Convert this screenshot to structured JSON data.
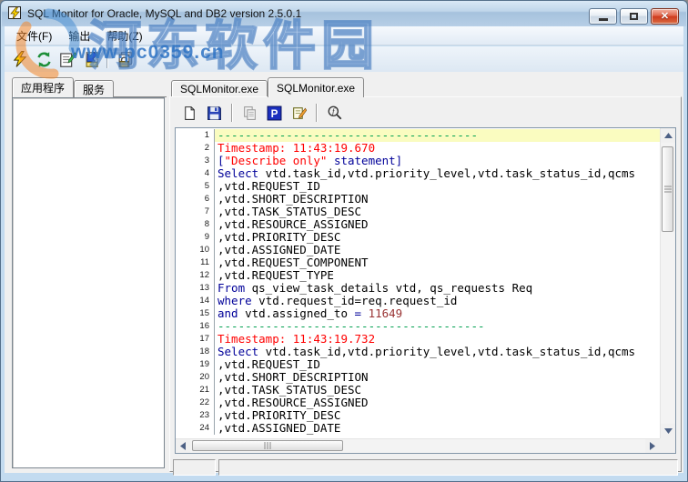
{
  "window": {
    "title": "SQL Monitor for Oracle, MySQL and DB2 version 2.5.0.1",
    "controls": [
      "minimize",
      "maximize",
      "close"
    ]
  },
  "menu": {
    "items": [
      "文件(F)",
      "输出",
      "帮助(Z)"
    ]
  },
  "main_toolbar": {
    "icons": [
      "execute-icon",
      "refresh-icon",
      "log-options-icon",
      "save-output-icon",
      "lock-icon"
    ]
  },
  "left_panel": {
    "tabs": [
      {
        "label": "应用程序",
        "active": true
      },
      {
        "label": "服务",
        "active": false
      }
    ],
    "process_list": []
  },
  "right_panel": {
    "tabs": [
      {
        "label": "SQLMonitor.exe",
        "active": false
      },
      {
        "label": "SQLMonitor.exe",
        "active": true
      }
    ],
    "toolbar": {
      "icons": [
        "new-file-icon",
        "save-icon",
        "copy-icon",
        "pause-icon",
        "clear-icon",
        "find-icon"
      ]
    },
    "editor": {
      "lines": [
        {
          "n": 1,
          "hl": true,
          "seg": [
            [
              "green",
              "--------------------------------------"
            ]
          ]
        },
        {
          "n": 2,
          "seg": [
            [
              "red",
              "Timestamp: 11:43:19.670"
            ]
          ]
        },
        {
          "n": 3,
          "seg": [
            [
              "navy",
              "["
            ],
            [
              "red",
              "\"Describe only\""
            ],
            [
              "navy",
              " statement]"
            ]
          ]
        },
        {
          "n": 4,
          "seg": [
            [
              "navy",
              "Select"
            ],
            [
              "black",
              " vtd.task_id,vtd.priority_level,vtd.task_status_id,qcms"
            ]
          ]
        },
        {
          "n": 5,
          "seg": [
            [
              "black",
              ",vtd.REQUEST_ID"
            ]
          ]
        },
        {
          "n": 6,
          "seg": [
            [
              "black",
              ",vtd.SHORT_DESCRIPTION"
            ]
          ]
        },
        {
          "n": 7,
          "seg": [
            [
              "black",
              ",vtd.TASK_STATUS_DESC"
            ]
          ]
        },
        {
          "n": 8,
          "seg": [
            [
              "black",
              ",vtd.RESOURCE_ASSIGNED"
            ]
          ]
        },
        {
          "n": 9,
          "seg": [
            [
              "black",
              ",vtd.PRIORITY_DESC"
            ]
          ]
        },
        {
          "n": 10,
          "seg": [
            [
              "black",
              ",vtd.ASSIGNED_DATE"
            ]
          ]
        },
        {
          "n": 11,
          "seg": [
            [
              "black",
              ",vtd.REQUEST_COMPONENT"
            ]
          ]
        },
        {
          "n": 12,
          "seg": [
            [
              "black",
              ",vtd.REQUEST_TYPE"
            ]
          ]
        },
        {
          "n": 13,
          "seg": [
            [
              "navy",
              "From"
            ],
            [
              "black",
              " qs_view_task_details vtd, qs_requests Req"
            ]
          ]
        },
        {
          "n": 14,
          "seg": [
            [
              "navy",
              "where"
            ],
            [
              "black",
              " vtd.request_id=req.request_id"
            ]
          ]
        },
        {
          "n": 15,
          "seg": [
            [
              "navy",
              "and"
            ],
            [
              "black",
              " vtd.assigned_to "
            ],
            [
              "navy",
              "="
            ],
            [
              "black",
              " "
            ],
            [
              "maroon",
              "11649"
            ]
          ]
        },
        {
          "n": 16,
          "seg": [
            [
              "green",
              "---------------------------------------"
            ]
          ]
        },
        {
          "n": 17,
          "seg": [
            [
              "red",
              "Timestamp: 11:43:19.732"
            ]
          ]
        },
        {
          "n": 18,
          "seg": [
            [
              "navy",
              "Select"
            ],
            [
              "black",
              " vtd.task_id,vtd.priority_level,vtd.task_status_id,qcms"
            ]
          ]
        },
        {
          "n": 19,
          "seg": [
            [
              "black",
              ",vtd.REQUEST_ID"
            ]
          ]
        },
        {
          "n": 20,
          "seg": [
            [
              "black",
              ",vtd.SHORT_DESCRIPTION"
            ]
          ]
        },
        {
          "n": 21,
          "seg": [
            [
              "black",
              ",vtd.TASK_STATUS_DESC"
            ]
          ]
        },
        {
          "n": 22,
          "seg": [
            [
              "black",
              ",vtd.RESOURCE_ASSIGNED"
            ]
          ]
        },
        {
          "n": 23,
          "seg": [
            [
              "black",
              ",vtd.PRIORITY_DESC"
            ]
          ]
        },
        {
          "n": 24,
          "seg": [
            [
              "black",
              ",vtd.ASSIGNED_DATE"
            ]
          ]
        }
      ]
    },
    "status_bar": {
      "cells": [
        "",
        ""
      ]
    }
  },
  "watermark": {
    "site_name": "河东软件园",
    "url": "www.pc0359.cn"
  },
  "colors": {
    "green": "#00A050",
    "red": "#FF0000",
    "navy": "#000099",
    "black": "#000000",
    "maroon": "#993333",
    "line_highlight": "#FAFCC0",
    "titlebar_blue": "#B6CEE6",
    "close_red": "#CE3A1E"
  }
}
